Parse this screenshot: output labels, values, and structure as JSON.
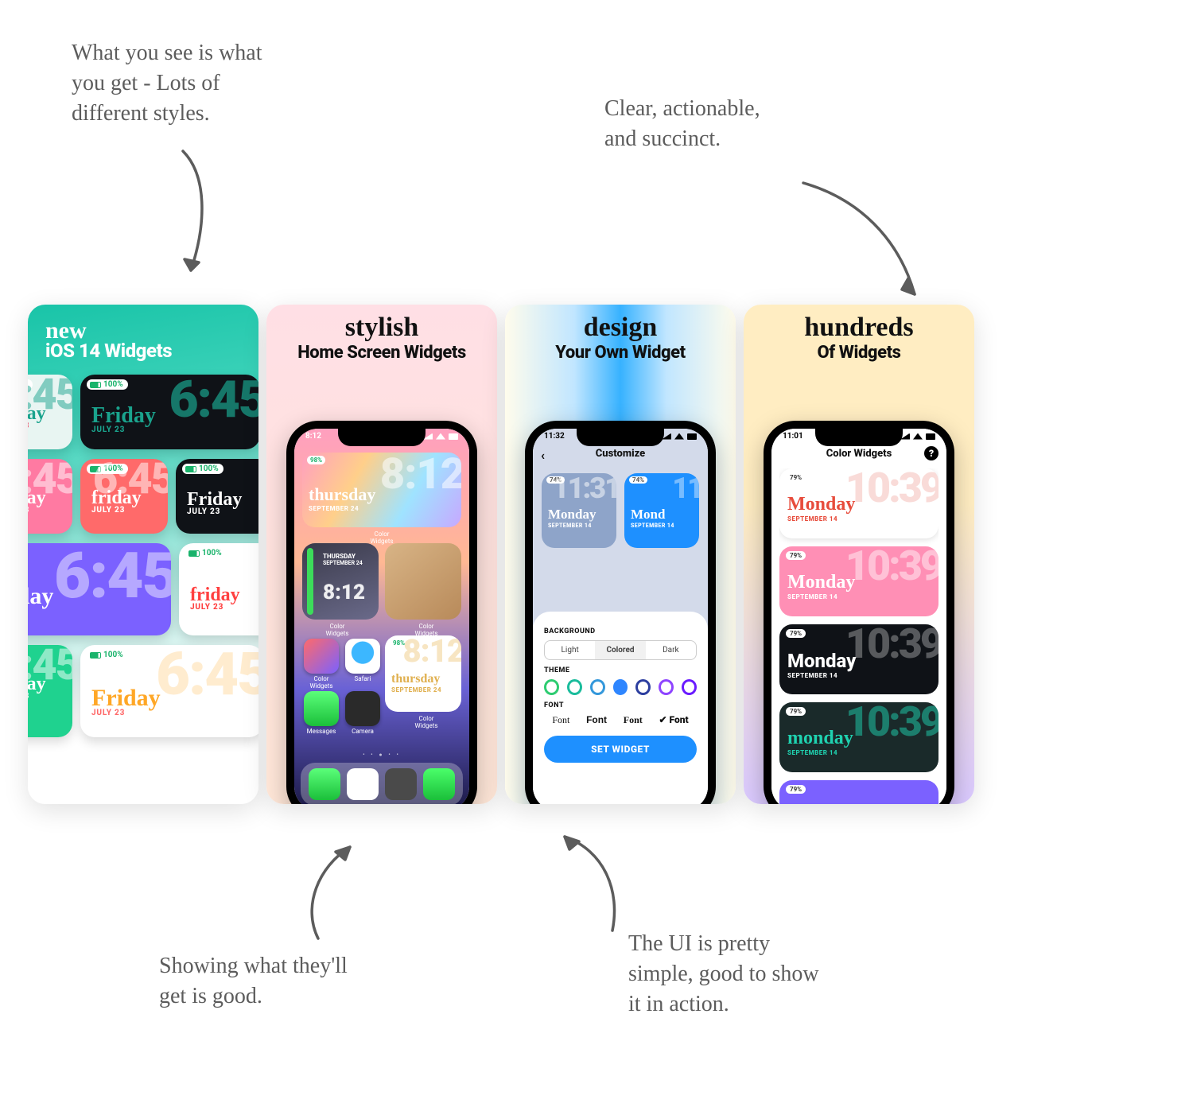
{
  "notes": {
    "topLeft": "What you see is what\nyou get - Lots of\ndifferent styles.",
    "topRight": "Clear, actionable,\nand succinct.",
    "bottomLeft": "Showing what they'll\nget is good.",
    "bottomRight": "The UI is pretty\nsimple, good to show\nit in action."
  },
  "shot1": {
    "scriptWord": "new",
    "subtitle": "iOS 14 Widgets",
    "battery": "100%",
    "day": "Friday",
    "dayScript": "friday",
    "date": "JULY 23",
    "time": "6:45"
  },
  "shot2": {
    "scriptWord": "stylish",
    "subtitle": "Home Screen Widgets",
    "statusTime": "8:12",
    "widget": {
      "battery": "98%",
      "time": "8:12",
      "day": "thursday",
      "dayCaps": "THURSDAY",
      "date": "SEPTEMBER 24"
    },
    "apps": [
      "Color Widgets",
      "Safari",
      "Messages",
      "Camera",
      "Color Widgets",
      "Color Widgets",
      "Color Widgets"
    ]
  },
  "shot3": {
    "scriptWord": "design",
    "subtitle": "Your Own Widget",
    "statusTime": "11:32",
    "screenTitle": "Customize",
    "preview": {
      "battery": "74%",
      "time": "11:31",
      "day": "Monday",
      "dayShort": "Mond",
      "date": "SEPTEMBER 14"
    },
    "labels": {
      "background": "BACKGROUND",
      "theme": "THEME",
      "font": "FONT"
    },
    "segments": [
      "Light",
      "Colored",
      "Dark"
    ],
    "fonts": [
      "Font",
      "Font",
      "Font",
      "Font"
    ],
    "button": "SET WIDGET"
  },
  "shot4": {
    "scriptWord": "hundreds",
    "subtitle": "Of Widgets",
    "statusTime": "11:01",
    "screenTitle": "Color Widgets",
    "battery": "79%",
    "time": "10:39",
    "day": "Monday",
    "dayScript": "monday",
    "date": "SEPTEMBER 14"
  }
}
